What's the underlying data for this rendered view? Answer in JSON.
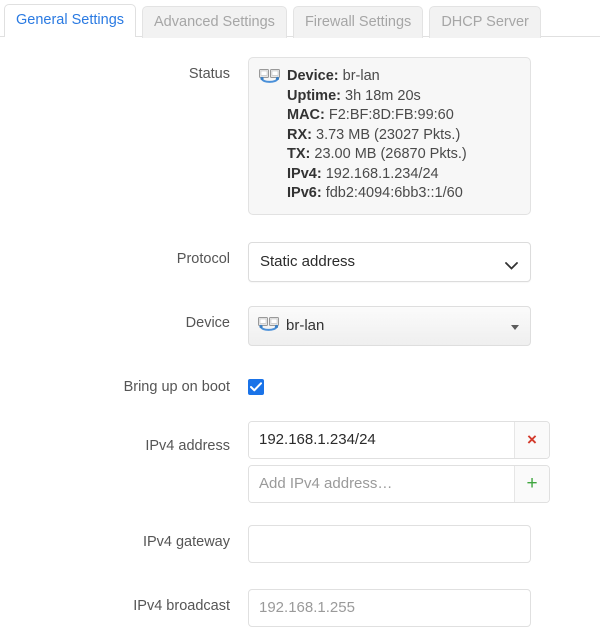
{
  "tabs": [
    {
      "label": "General Settings",
      "active": true
    },
    {
      "label": "Advanced Settings",
      "active": false
    },
    {
      "label": "Firewall Settings",
      "active": false
    },
    {
      "label": "DHCP Server",
      "active": false
    }
  ],
  "colors": {
    "active_tab_text": "#2a7ae2",
    "inactive_tab_text": "#a6a6a6",
    "checkbox_checked": "#1a73e8",
    "remove_button": "#d33a2c",
    "add_button": "#3fa63f"
  },
  "form": {
    "status": {
      "label": "Status",
      "icon": "network-bridge-icon",
      "lines": [
        {
          "key": "Device:",
          "value": "br-lan"
        },
        {
          "key": "Uptime:",
          "value": "3h 18m 20s"
        },
        {
          "key": "MAC:",
          "value": "F2:BF:8D:FB:99:60"
        },
        {
          "key": "RX:",
          "value": "3.73 MB (23027 Pkts.)"
        },
        {
          "key": "TX:",
          "value": "23.00 MB (26870 Pkts.)"
        },
        {
          "key": "IPv4:",
          "value": "192.168.1.234/24"
        },
        {
          "key": "IPv6:",
          "value": "fdb2:4094:6bb3::1/60"
        }
      ]
    },
    "protocol": {
      "label": "Protocol",
      "value": "Static address",
      "icon": "chevron-down-icon"
    },
    "device": {
      "label": "Device",
      "value": "br-lan",
      "icon": "network-bridge-icon",
      "caret": "caret-down-icon"
    },
    "bring_up_on_boot": {
      "label": "Bring up on boot",
      "checked": true
    },
    "ipv4_address": {
      "label": "IPv4 address",
      "entries": [
        {
          "value": "192.168.1.234/24",
          "button": "×",
          "button_name": "remove"
        }
      ],
      "add_placeholder": "Add IPv4 address…",
      "add_button": "+"
    },
    "ipv4_gateway": {
      "label": "IPv4 gateway",
      "value": "",
      "placeholder": ""
    },
    "ipv4_broadcast": {
      "label": "IPv4 broadcast",
      "value": "",
      "placeholder": "192.168.1.255"
    }
  }
}
